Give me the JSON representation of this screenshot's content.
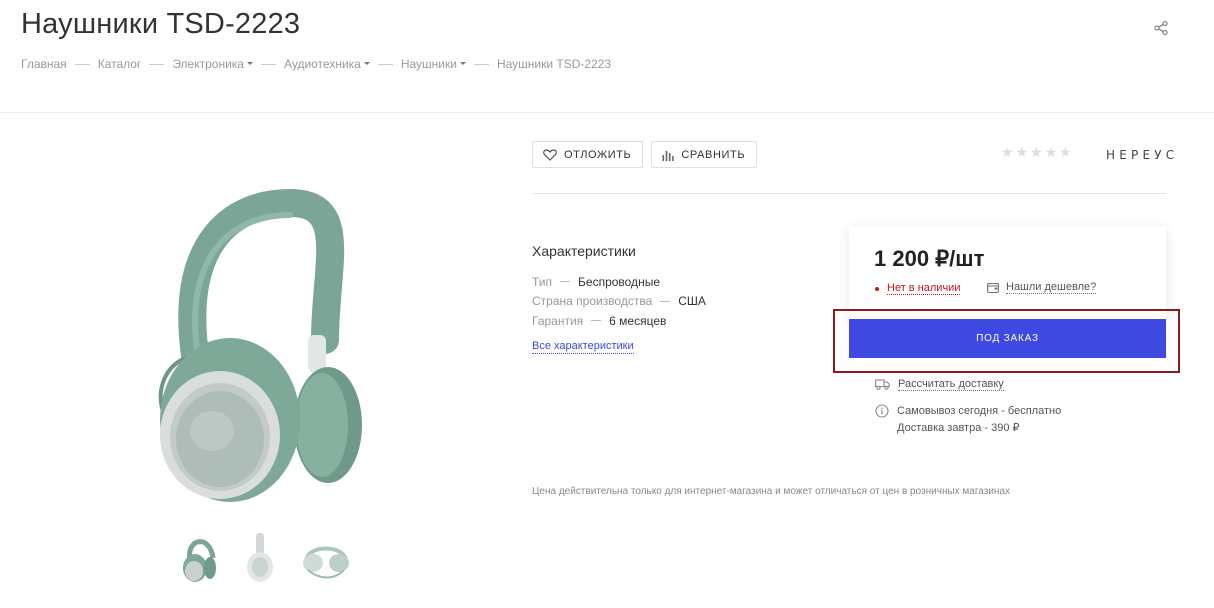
{
  "page": {
    "title": "Наушники TSD-2223",
    "share_icon": "share-icon"
  },
  "breadcrumb": [
    {
      "label": "Главная",
      "has_dropdown": false
    },
    {
      "label": "Каталог",
      "has_dropdown": false
    },
    {
      "label": "Электроника",
      "has_dropdown": true
    },
    {
      "label": "Аудиотехника",
      "has_dropdown": true
    },
    {
      "label": "Наушники",
      "has_dropdown": true
    },
    {
      "label": "Наушники TSD-2223",
      "has_dropdown": false
    }
  ],
  "actions": {
    "wishlist_label": "ОТЛОЖИТЬ",
    "compare_label": "СРАВНИТЬ"
  },
  "rating": {
    "stars_total": 5,
    "stars_filled": 0
  },
  "brand": {
    "logo_text": "НЕРЕУС"
  },
  "properties": {
    "title": "Характеристики",
    "items": [
      {
        "key": "Тип",
        "value": "Беспроводные"
      },
      {
        "key": "Страна производства",
        "value": "США"
      },
      {
        "key": "Гарантия",
        "value": "6 месяцев"
      }
    ],
    "all_link": "Все характеристики"
  },
  "offer": {
    "price": "1 200 ₽/шт",
    "stock_status": "Нет в наличии",
    "cheaper_link": "Нашли дешевле?",
    "order_button": "ПОД ЗАКАЗ",
    "delivery_calc": "Рассчитать доставку",
    "pickup_line": "Самовывоз сегодня - бесплатно",
    "delivery_line": "Доставка завтра - 390 ₽"
  },
  "note": "Цена действительна только для интернет-магазина и может отличаться от цен в розничных магазинах",
  "colors": {
    "accent": "#3d49e0",
    "out_of_stock": "#d0141f",
    "link": "#3a4bd6",
    "highlight_box": "#8b1a1a"
  }
}
